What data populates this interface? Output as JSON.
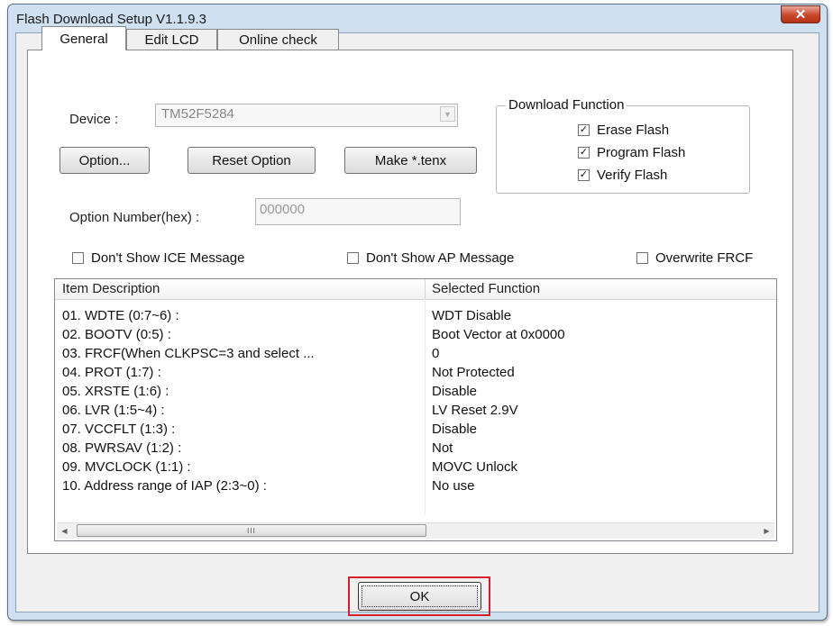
{
  "window": {
    "title": "Flash Download Setup V1.1.9.3",
    "close_glyph": "✕"
  },
  "tabs": [
    {
      "label": "General"
    },
    {
      "label": "Edit LCD"
    },
    {
      "label": "Online check"
    }
  ],
  "device": {
    "label": "Device :",
    "value": "TM52F5284"
  },
  "buttons": {
    "option": "Option...",
    "reset_option": "Reset Option",
    "make_tenx": "Make *.tenx",
    "ok": "OK"
  },
  "option_number": {
    "label": "Option Number(hex) :",
    "value": "000000"
  },
  "download_function": {
    "title": "Download Function",
    "items": [
      {
        "label": "Erase Flash",
        "checked": "☑"
      },
      {
        "label": "Program Flash",
        "checked": "☑"
      },
      {
        "label": "Verify Flash",
        "checked": "☑"
      }
    ]
  },
  "checks": {
    "ice": "Don't Show ICE Message",
    "ap": "Don't Show AP Message",
    "frcf": "Overwrite FRCF"
  },
  "check_mark": "✓",
  "list": {
    "headers": [
      "Item Description",
      "Selected Function"
    ],
    "rows": [
      [
        "01. WDTE (0:7~6) :",
        "WDT Disable"
      ],
      [
        "02. BOOTV (0:5) :",
        "Boot Vector at 0x0000"
      ],
      [
        "03. FRCF(When CLKPSC=3 and select ...",
        "0"
      ],
      [
        "04. PROT (1:7) :",
        "Not Protected"
      ],
      [
        "05. XRSTE (1:6) :",
        "Disable"
      ],
      [
        "06. LVR (1:5~4) :",
        "LV Reset 2.9V"
      ],
      [
        "07. VCCFLT (1:3) :",
        "Disable"
      ],
      [
        "08. PWRSAV (1:2) :",
        "Not"
      ],
      [
        "09. MVCLOCK (1:1) :",
        "MOVC Unlock"
      ],
      [
        "10. Address range of IAP (2:3~0)  :",
        "No use"
      ]
    ],
    "scroll_left": "◀",
    "scroll_right": "▶",
    "scroll_grip": "III"
  },
  "colors": {
    "highlight": "#d81f27",
    "close": "#c9462b"
  }
}
